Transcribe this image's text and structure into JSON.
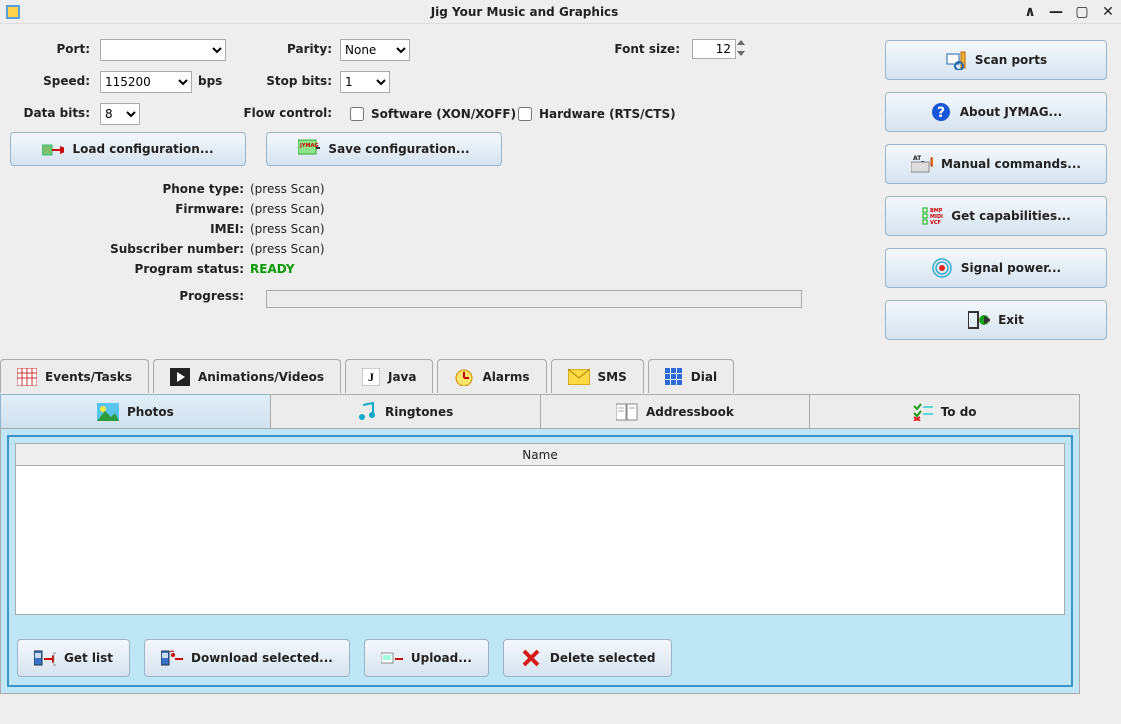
{
  "window": {
    "title": "Jig Your Music and Graphics"
  },
  "port_settings": {
    "port_label": "Port:",
    "port_value": "",
    "speed_label": "Speed:",
    "speed_value": "115200",
    "speed_unit": "bps",
    "databits_label": "Data bits:",
    "databits_value": "8",
    "parity_label": "Parity:",
    "parity_value": "None",
    "stopbits_label": "Stop bits:",
    "stopbits_value": "1",
    "flow_label": "Flow control:",
    "flow_software": "Software (XON/XOFF)",
    "flow_hardware": "Hardware (RTS/CTS)",
    "fontsize_label": "Font size:",
    "fontsize_value": "12"
  },
  "config_buttons": {
    "load": "Load configuration...",
    "save": "Save configuration..."
  },
  "info": {
    "phone_type_label": "Phone type:",
    "phone_type_value": "(press Scan)",
    "firmware_label": "Firmware:",
    "firmware_value": "(press Scan)",
    "imei_label": "IMEI:",
    "imei_value": "(press Scan)",
    "subscriber_label": "Subscriber number:",
    "subscriber_value": "(press Scan)",
    "status_label": "Program status:",
    "status_value": "READY",
    "progress_label": "Progress:"
  },
  "side_buttons": {
    "scan": "Scan ports",
    "about": "About JYMAG...",
    "manual": "Manual commands...",
    "caps": "Get capabilities...",
    "signal": "Signal power...",
    "exit": "Exit"
  },
  "tabs_row1": [
    "Events/Tasks",
    "Animations/Videos",
    "Java",
    "Alarms",
    "SMS",
    "Dial"
  ],
  "tabs_row2": [
    "Photos",
    "Ringtones",
    "Addressbook",
    "To do"
  ],
  "panel": {
    "name_col": "Name",
    "get_list": "Get list",
    "download": "Download selected...",
    "upload": "Upload...",
    "delete": "Delete selected"
  }
}
